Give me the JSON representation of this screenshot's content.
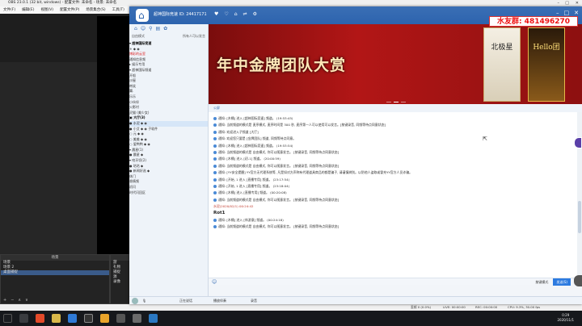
{
  "obs": {
    "title": "OBS 23.0.1 (32 bit, windows) - 配置文件: 未命名 - 场景: 未命名",
    "menu": [
      "文件(F)",
      "编辑(E)",
      "视图(V)",
      "配置文件(P)",
      "场景集合(S)",
      "工具(T)",
      "帮助(H)"
    ],
    "scenes": {
      "header": "场景",
      "items": [
        "场景",
        "场景 2",
        "桌面捕捉"
      ]
    },
    "sources": {
      "header": "",
      "items": [
        "游",
        "礼物",
        "捕捉",
        "源",
        "录像"
      ]
    },
    "status": {
      "dropped": "丢帧 0 (0.0%)",
      "live": "LIVE: 00:00:00",
      "rec": "REC: 00:00:00",
      "cpu": "CPU: 9.3%, 30.00 fps"
    }
  },
  "yy": {
    "channel": "超神国际竞速 ID: 24417171",
    "fan_badge": "水友群: 481496270",
    "left": {
      "sub_left": "自由模式",
      "sub_right": "所有人可以发言",
      "tree": [
        {
          "text": "▾ 超神国际竞速",
          "style": "b"
        },
        {
          "text": "   ⚜ ◆ ◉",
          "style": ""
        },
        {
          "text": "   博彩的云室",
          "style": "red"
        },
        {
          "text": "   通知信息频",
          "style": ""
        },
        {
          "text": " ▸ 娱乐专用",
          "style": ""
        },
        {
          "text": " ▾ 超神国际频道",
          "style": ""
        },
        {
          "text": "      开船",
          "style": ""
        },
        {
          "text": "      沙屋",
          "style": ""
        },
        {
          "text": "      带笑",
          "style": ""
        },
        {
          "text": "      翼.",
          "style": ""
        },
        {
          "text": "      乐乐",
          "style": ""
        },
        {
          "text": "      小伙伴",
          "style": ""
        },
        {
          "text": "      火影村",
          "style": ""
        },
        {
          "text": "      灵猫 (美少女)",
          "style": ""
        },
        {
          "text": " ▣ 大厅(3)",
          "style": "b"
        },
        {
          "text": "   ● 水泥 ◆ ◉",
          "style": "sel"
        },
        {
          "text": "   ● 小艾 ◆ ◉ 子软件",
          "style": ""
        },
        {
          "text": "   ○ 元 ◆ ◉",
          "style": ""
        },
        {
          "text": "   ○ 美美 ◆ ◉",
          "style": ""
        },
        {
          "text": "   ○ 爱鸭鸭 ◆ ◉",
          "style": ""
        },
        {
          "text": " ▾ 晨星(1)",
          "style": ""
        },
        {
          "text": "      ● 晨星 ◆",
          "style": ""
        },
        {
          "text": " ▾ 咬牙切(2)",
          "style": ""
        },
        {
          "text": "      ● 咕咕 ◆",
          "style": ""
        },
        {
          "text": "      ● 新闻好选 ◆",
          "style": ""
        },
        {
          "text": "   休门",
          "style": ""
        },
        {
          "text": "   香情频",
          "style": ""
        },
        {
          "text": "   初闪",
          "style": ""
        },
        {
          "text": "   时代闪回区",
          "style": ""
        }
      ]
    },
    "banner": {
      "title": "年中金牌团队大赏",
      "card1": "北极星",
      "card2": "Hello团"
    },
    "chat_header": "公屏",
    "messages": [
      {
        "text": "通知: [木桶] 进入 [超神国际竞速] 频道。 (19:53:45)",
        "style": ""
      },
      {
        "text": "通知: 当前频道的模式是 麦序模式, 麦序时间是 300 秒, 麦序第一人可以使用可以发言。[按键录音, 同频等待点同意状态]",
        "style": ""
      },
      {
        "text": "通知: 欢迎进入子频道 [大厅]",
        "style": ""
      },
      {
        "text": "通知: 欢迎您只要是 [金牌团队] 频道, 同频等待点同意。",
        "style": ""
      },
      {
        "text": "通知: [木桶] 进入 [超神国际竞速] 频道。 (19:53:54)",
        "style": ""
      },
      {
        "text": "通知: 当前频道的模式是 自由模式, 你可以随意发言。 [按键录音, 同频等待点同意状态]",
        "style": ""
      },
      {
        "text": "通知: [木桶] 进入 [初-1] 频道。 (20:00:59)",
        "style": ""
      },
      {
        "text": "通知: 当前频道的模式是 自由模式, 你可以随意发言。 [按键录音, 同频等待点同意状态]",
        "style": ""
      },
      {
        "text": "通知: [YY安全提醒] YY官方无代理系统等, 凡是如对方声称有代理道具商品的都是骗子, 请谨慎辨别。以防他人盗取或冒充YY官方人员诈骗。",
        "style": ""
      },
      {
        "text": "通知: [开始, 1 进入 [直播专用] 频道。 (23:17:54)",
        "style": ""
      },
      {
        "text": "通知: [开始, 1 进入 [直播专用] 频道。 (23:18:04)",
        "style": ""
      },
      {
        "text": "通知: [木桶] 进入 [直播专用] 频道。 (00:20:08)",
        "style": ""
      },
      {
        "text": "通知: 当前频道的模式是 自由模式, 你可以随意发言。 [按键录音, 同频等待点同意状态]",
        "style": ""
      },
      {
        "text": "水泥(2020/02/1) 00:24:42",
        "style": "ts"
      },
      {
        "text": "Rot1",
        "style": "big"
      },
      {
        "text": "通知: [木桶] 进入 [休游意] 频道。 (00:24:18)",
        "style": ""
      },
      {
        "text": "通知: 当前频道的模式是 自由模式, 你可以随意发言。 [按键录音, 同频等待点同意状态]",
        "style": ""
      }
    ],
    "input": {
      "mode": "按键模式",
      "send": "发送(S)"
    },
    "bottom": {
      "status": "正在说话",
      "live": "播放伴奏",
      "record": "录音"
    }
  },
  "taskbar": {
    "time": "0:29",
    "date": "2020/11/1"
  },
  "colors": {
    "yy_blue": "#2d63ae",
    "banner_red": "#b21616",
    "fan_badge": "#e11111"
  }
}
